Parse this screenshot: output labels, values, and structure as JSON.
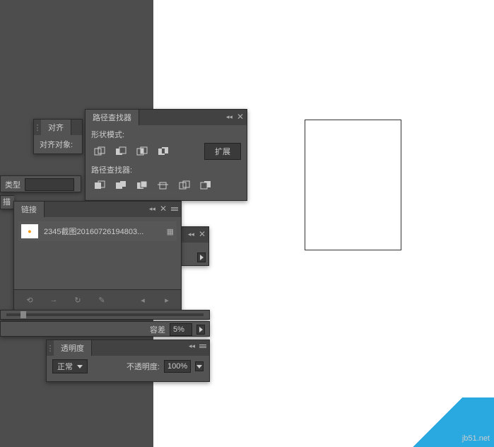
{
  "align_panel": {
    "tab": "对齐",
    "align_objects": "对齐对象:"
  },
  "pathfinder_panel": {
    "tab": "路径查找器",
    "shape_modes": "形状模式:",
    "expand": "扩展",
    "pathfinders": "路径查找器:",
    "mode_icons": [
      "unite-icon",
      "minus-front-icon",
      "intersect-icon",
      "exclude-icon"
    ],
    "pf_icons": [
      "divide-icon",
      "trim-icon",
      "merge-icon",
      "crop-icon",
      "outline-icon",
      "minus-back-icon"
    ]
  },
  "type_panel": {
    "label": "类型"
  },
  "stroke_panel": {
    "label_partial": "描"
  },
  "links_panel": {
    "tab": "链接",
    "items": [
      {
        "name": "2345截图20160726194803...",
        "thumb": "●"
      }
    ],
    "footer_icons": [
      "relink-icon",
      "goto-link-icon",
      "update-link-icon",
      "edit-original-icon"
    ],
    "nav_icons": [
      "prev-icon",
      "next-icon"
    ]
  },
  "tolerance_panel": {
    "label": "容差",
    "value": "5%"
  },
  "transparency_panel": {
    "tab": "透明度",
    "blend_mode": "正常",
    "opacity_label": "不透明度:",
    "opacity_value": "100%"
  },
  "watermark": {
    "text": "jb51.net"
  }
}
